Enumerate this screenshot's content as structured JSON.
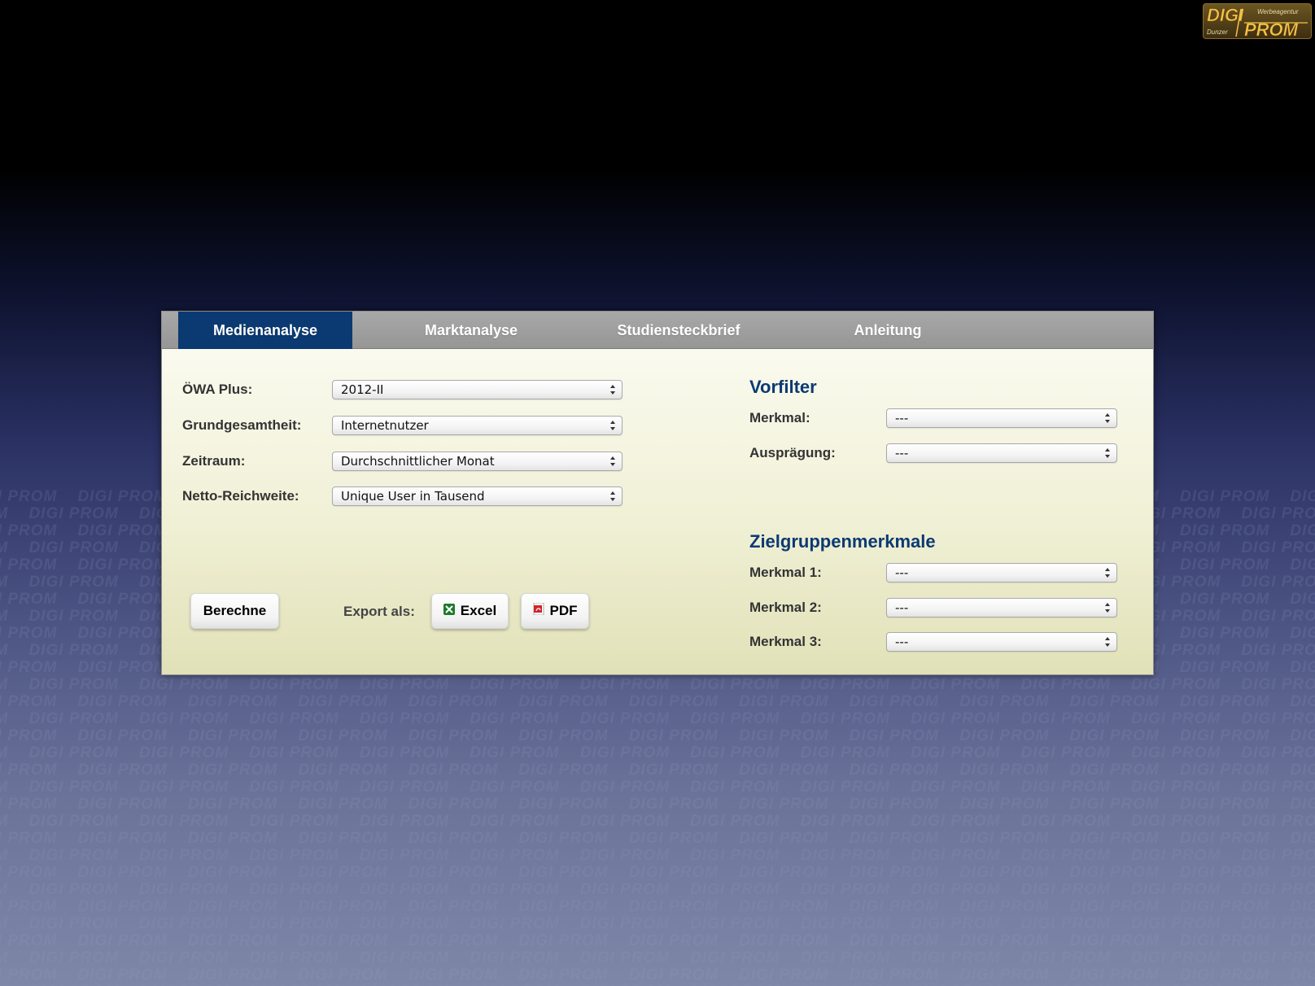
{
  "logo": {
    "top_text": "DIGI",
    "bottom_text": "PROM",
    "tagline": "Werbeagentur",
    "side_text": "Dunzer"
  },
  "watermark": {
    "text": "DIGI PROM"
  },
  "tabs": [
    {
      "label": "Medienanalyse",
      "active": true
    },
    {
      "label": "Marktanalyse",
      "active": false
    },
    {
      "label": "Studiensteckbrief",
      "active": false
    },
    {
      "label": "Anleitung",
      "active": false
    }
  ],
  "left_form": {
    "rows": [
      {
        "label": "ÖWA Plus:",
        "value": "2012-II"
      },
      {
        "label": "Grundgesamtheit:",
        "value": "Internetnutzer"
      },
      {
        "label": "Zeitraum:",
        "value": "Durchschnittlicher Monat"
      },
      {
        "label": "Netto-Reichweite:",
        "value": "Unique User in Tausend"
      }
    ]
  },
  "vorfilter": {
    "title": "Vorfilter",
    "rows": [
      {
        "label": "Merkmal:",
        "value": "---"
      },
      {
        "label": "Ausprägung:",
        "value": "---"
      }
    ]
  },
  "zielgruppen": {
    "title": "Zielgruppenmerkmale",
    "rows": [
      {
        "label": "Merkmal 1:",
        "value": "---"
      },
      {
        "label": "Merkmal 2:",
        "value": "---"
      },
      {
        "label": "Merkmal 3:",
        "value": "---"
      }
    ]
  },
  "actions": {
    "calculate_label": "Berechne",
    "export_label": "Export als:",
    "excel_label": "Excel",
    "pdf_label": "PDF"
  },
  "colors": {
    "accent": "#0b3a72",
    "tabbar": "#9e9e9e",
    "excel_icon": "#1d7a2e",
    "pdf_icon": "#d1232a"
  }
}
